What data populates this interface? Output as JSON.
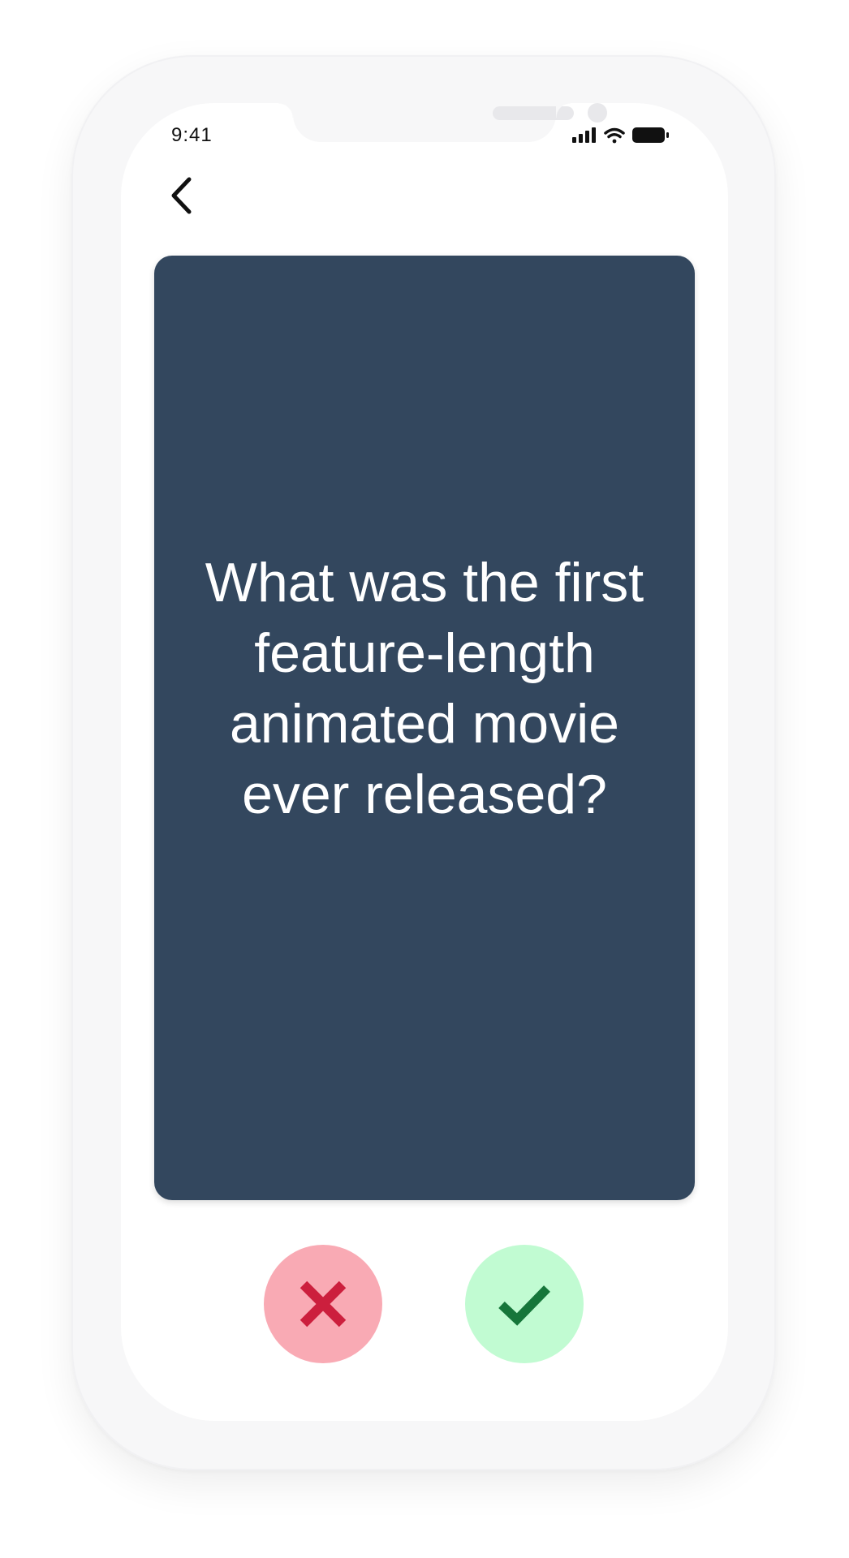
{
  "status_bar": {
    "time": "9:41",
    "icons": [
      "cellular-signal-icon",
      "wifi-icon",
      "battery-icon"
    ]
  },
  "navigation": {
    "back_icon": "chevron-left-icon"
  },
  "flashcard": {
    "question": "What was the first feature-length animated movie ever released?"
  },
  "actions": {
    "wrong": {
      "icon": "cross-icon",
      "color": "#cc1f3d",
      "background": "#f9aab4"
    },
    "correct": {
      "icon": "check-icon",
      "color": "#16763a",
      "background": "#c1fbd2"
    }
  },
  "colors": {
    "card_background": "#33475e",
    "card_text": "#ffffff"
  }
}
